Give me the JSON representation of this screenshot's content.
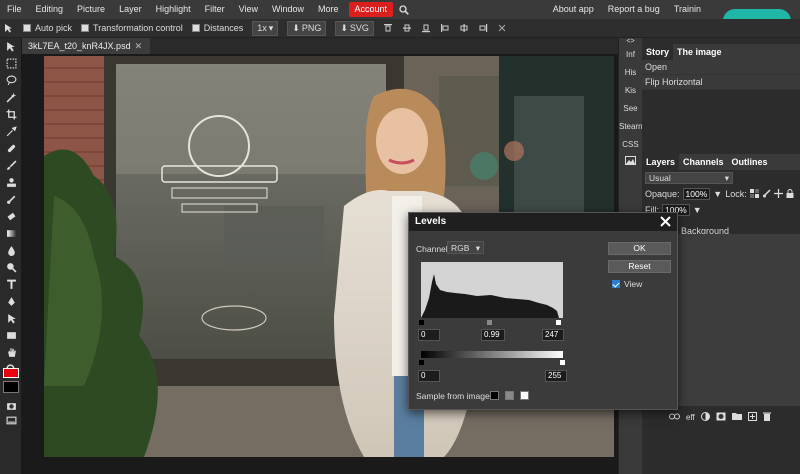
{
  "menu": {
    "items": [
      "File",
      "Editing",
      "Picture",
      "Layer",
      "Highlight",
      "Filter",
      "View",
      "Window",
      "More"
    ],
    "account": "Account",
    "right_items": [
      "About app",
      "Report a bug",
      "Trainin"
    ]
  },
  "options": {
    "auto_pick": "Auto pick",
    "transformation_control": "Transformation control",
    "distances": "Distances",
    "zoom": "1x",
    "png": "PNG",
    "svg": "SVG"
  },
  "document": {
    "tab_name": "3kL7EA_t20_knR4JX.psd"
  },
  "mini_panel": [
    "Inf",
    "His",
    "Kis",
    "See",
    "Stearn",
    "CSS"
  ],
  "history_panel": {
    "tabs": [
      "Story",
      "The image"
    ],
    "items": [
      "Open",
      "Flip Horizontal"
    ]
  },
  "layers_panel": {
    "tabs": [
      "Layers",
      "Channels",
      "Outlines"
    ],
    "blend_mode": "Usual",
    "opaque_label": "Opaque:",
    "opaque_value": "100%",
    "lock_label": "Lock:",
    "fill_label": "Fill:",
    "fill_value": "100%",
    "layer_name": "Background",
    "footer_label": "eff"
  },
  "levels_dialog": {
    "title": "Levels",
    "channel_label": "Channel:",
    "channel_value": "RGB",
    "ok": "OK",
    "reset": "Reset",
    "view_label": "View",
    "input_black": "0",
    "input_gamma": "0.99",
    "input_white": "247",
    "output_black": "0",
    "output_white": "255",
    "sample_label": "Sample from image:"
  },
  "colors": {
    "accent_red": "#d9201f",
    "logo_teal": "#1fb5a7",
    "foreground": "#e8000c",
    "background": "#000000"
  }
}
